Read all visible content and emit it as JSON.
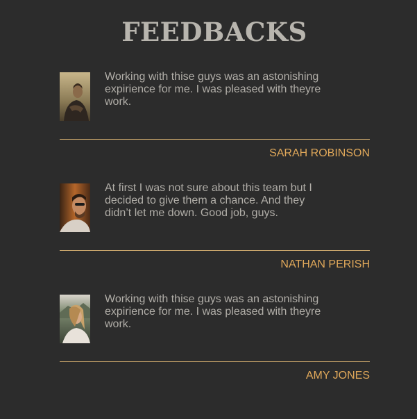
{
  "page": {
    "title": "FEEDBACKS"
  },
  "feedbacks": [
    {
      "quote": "Working with thise guys was an astonishing expirience for me. I was pleased with theyre work.",
      "author": "SARAH ROBINSON"
    },
    {
      "quote": "At first I was not sure about this team but I decided to give them a chance. And they didn’t let me down. Good job, guys.",
      "author": "NATHAN PERISH"
    },
    {
      "quote": "Working with thise guys was an astonishing expirience for me. I was pleased with theyre work.",
      "author": "AMY JONES"
    }
  ],
  "colors": {
    "background": "#2c2c2c",
    "title": "#b8b5ae",
    "text": "#b1aea8",
    "accent": "#e0a85a",
    "divider": "#c9a66b"
  }
}
